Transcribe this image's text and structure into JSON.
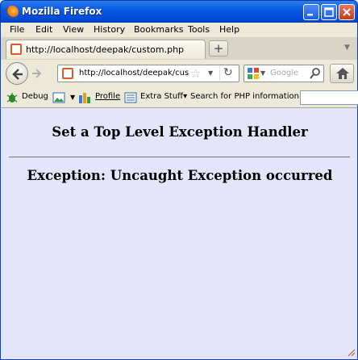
{
  "window": {
    "title": "Mozilla Firefox"
  },
  "menu": [
    "File",
    "Edit",
    "View",
    "History",
    "Bookmarks",
    "Tools",
    "Help"
  ],
  "tab": {
    "label": "http://localhost/deepak/custom.php"
  },
  "nav": {
    "url": "http://localhost/deepak/custom.php",
    "search_placeholder": "Google"
  },
  "bookmarks": {
    "debug": "Debug",
    "profile": "Profile",
    "extra": "Extra Stuff",
    "php_search_label": "Search for PHP information:"
  },
  "page": {
    "heading": "Set a Top Level Exception Handler",
    "message": "Exception: Uncaught Exception occurred",
    "background": "#e4e4fa"
  }
}
